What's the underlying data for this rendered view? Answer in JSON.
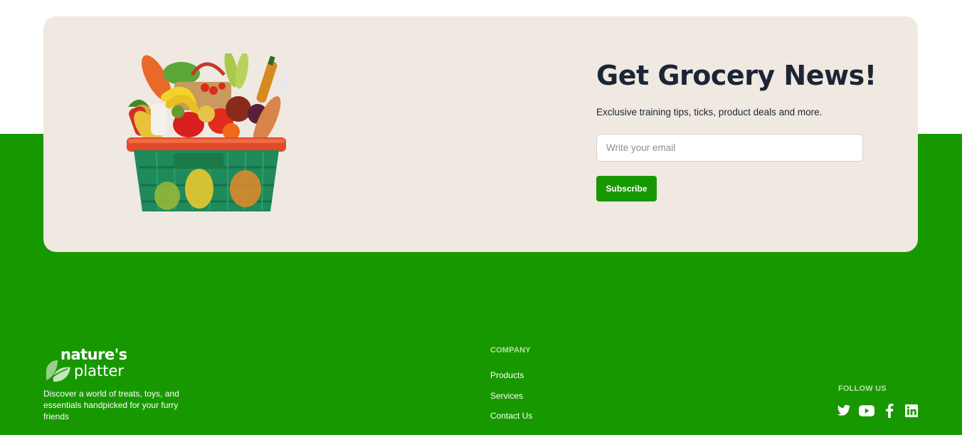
{
  "newsletter": {
    "title": "Get Grocery News!",
    "subtitle": "Exclusive training tips, ticks, product deals and more.",
    "email_placeholder": "Write your email",
    "email_value": "",
    "subscribe_label": "Subscribe"
  },
  "brand": {
    "name_line1": "nature's",
    "name_line2": "platter",
    "description": "Discover a world of treats, toys, and essentials handpicked for your furry friends"
  },
  "company": {
    "title": "COMPANY",
    "links": [
      "Products",
      "Services",
      "Contact Us"
    ]
  },
  "follow": {
    "title": "FOLLOW US",
    "icons": [
      "twitter-icon",
      "youtube-icon",
      "facebook-icon",
      "linkedin-icon"
    ]
  },
  "colors": {
    "brand_green": "#189800",
    "card_bg": "#efe9e1",
    "title_dark": "#1c2536"
  }
}
